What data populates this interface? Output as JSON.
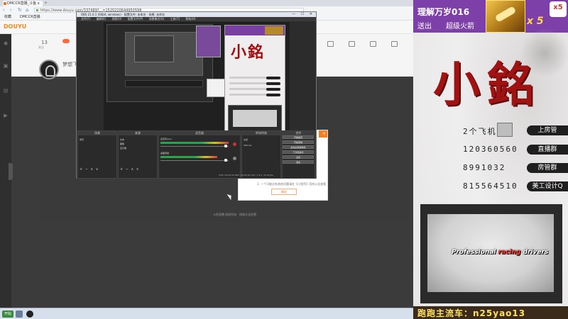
{
  "browser": {
    "tab_title": "DMCCR直播_斗鱼 x",
    "new_tab": "+",
    "url": "https://www.douyu.com/337489?...=1520220644950598",
    "nav": {
      "back": "‹",
      "forward": "›",
      "refresh": "↻",
      "home": "⌂"
    },
    "bookmarks": [
      "收藏",
      "DMCCR直播"
    ],
    "site_logo": "DOUYU"
  },
  "room": {
    "follower_count": "13",
    "follower_label": "关注",
    "streamer_name": "梦想飞翔",
    "footer_text": "斗鱼直播 版权所有 · 网络文化经营"
  },
  "obs": {
    "title": "OBS 21.0.1 (64bit, windows) - 配置文件: 未命名 - 场景: 未命名",
    "menu": [
      "文件(F)",
      "编辑(E)",
      "视图(V)",
      "配置文件(P)",
      "场景集合(S)",
      "工具(T)",
      "帮助(H)"
    ],
    "docks": {
      "scenes": "场景",
      "sources": "来源",
      "mixer": "混音器",
      "transitions": "转场特效",
      "controls": "控件"
    },
    "scene_item": "场景",
    "source_items": [
      "文本",
      "图像",
      "显示器"
    ],
    "mixer_labels": [
      "麦克风/Aux",
      "桌面音频"
    ],
    "transition_label": "淡出",
    "transition_duration": "300 ms",
    "control_buttons": [
      "开始推流",
      "开始录制",
      "启动虚拟摄像机",
      "工作室模式",
      "设置",
      "退出"
    ],
    "status": "LIVE: 00:00:00  REC: 00:00:00  CPU: 1.2%, 30.00 fps",
    "dock_toolbar": "+ − ∧ ∨"
  },
  "dialog": {
    "close": "×",
    "hint": "2. 一个可能还有其他问题请在【小程序】用戏公告查看",
    "confirm": "确定"
  },
  "taskbar": {
    "start": "开始"
  },
  "overlay": {
    "gift_user": "理解万岁016",
    "gift_action": "送出",
    "gift_name": "超级火箭",
    "gift_count": "x 5",
    "gift_badge": "x5",
    "logo": "小銘",
    "rows": [
      {
        "text": "2个飞机",
        "pill": "上房管"
      },
      {
        "text": "120360560",
        "pill": "直播群"
      },
      {
        "text": "8991032",
        "pill": "房管群"
      },
      {
        "text": "815564510",
        "pill": "美工设计Q"
      }
    ],
    "tagline_white": "Professional ",
    "tagline_red": "racing",
    "tagline_white2": " drivers",
    "bottom_text": "跑跑主流车：n25yao13"
  },
  "colors": {
    "overlay_purple": "#7d3fa8",
    "logo_red": "#a11212",
    "douyu_orange": "#f47e22",
    "gold_text": "#ffe060"
  }
}
